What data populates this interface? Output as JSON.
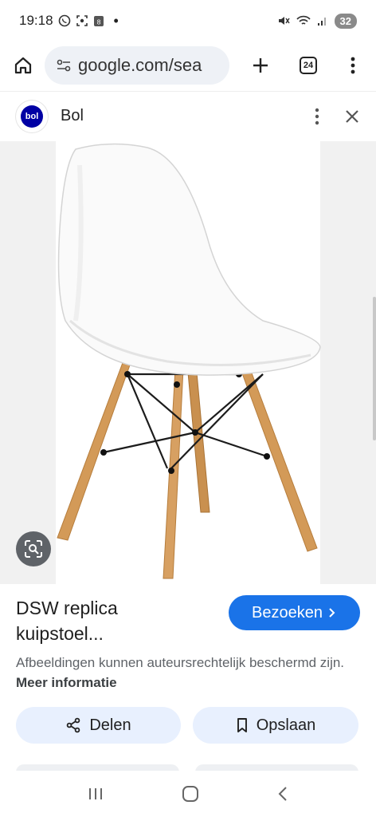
{
  "status": {
    "time": "19:18",
    "battery": "32",
    "icons": [
      "whatsapp-icon",
      "screenshot-icon",
      "calendar-icon",
      "dot-icon",
      "mute-icon",
      "wifi-icon",
      "signal-icon"
    ]
  },
  "browser": {
    "url": "google.com/sea",
    "tab_count": "24",
    "icons": [
      "home-icon",
      "site-info-icon",
      "new-tab-icon",
      "tabs-icon",
      "more-menu-icon"
    ]
  },
  "source": {
    "logo_text": "bol",
    "name": "Bol"
  },
  "image": {
    "subject": "white chair with wooden legs"
  },
  "result": {
    "title": "DSW replica kuipstoel...",
    "visit_label": "Bezoeken",
    "copyright_text": "Afbeeldingen kunnen auteursrechtelijk beschermd zijn.",
    "more_info_label": "Meer informatie",
    "share_label": "Delen",
    "save_label": "Opslaan"
  },
  "colors": {
    "accent": "#1a73e8",
    "pill": "#e8f0fe",
    "bol_brand": "#0000a4"
  }
}
